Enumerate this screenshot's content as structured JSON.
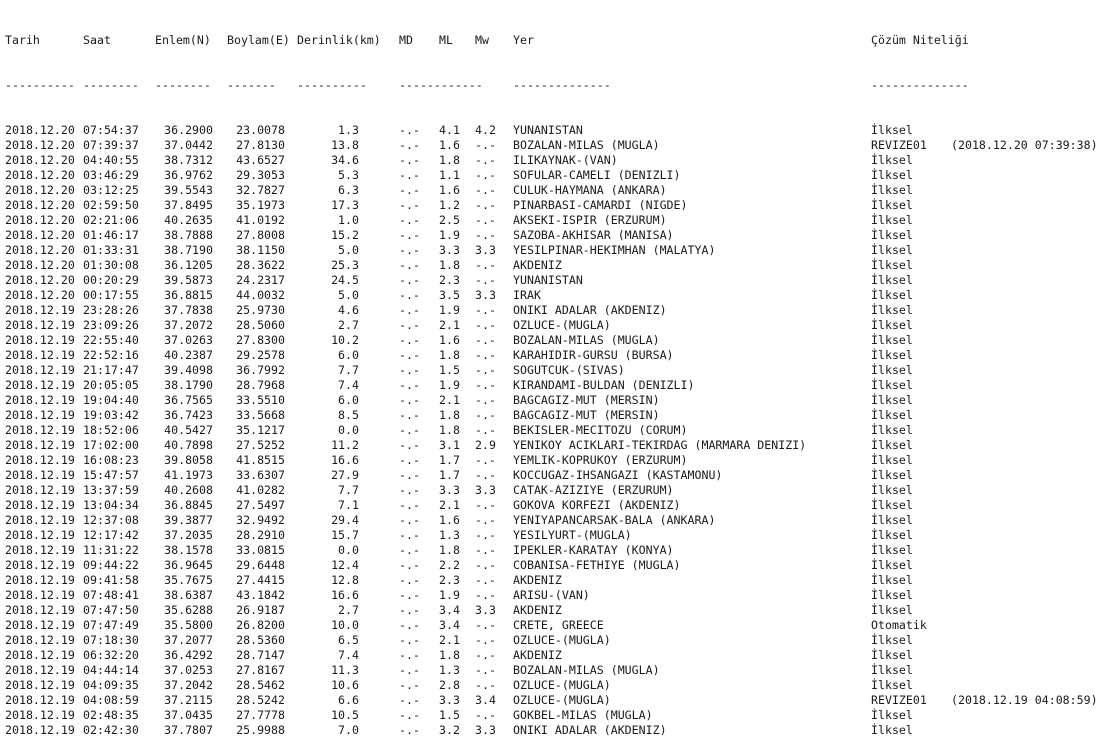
{
  "columns": {
    "date": "Tarih",
    "time": "Saat",
    "lat": "Enlem(N)",
    "lon": "Boylam(E)",
    "depth": "Derinlik(km)",
    "md": "MD",
    "ml": "ML",
    "mw": "Mw",
    "location": "Yer",
    "quality": "Çözüm Niteliği"
  },
  "separators": {
    "date": "----------",
    "time": "--------",
    "lat": "--------",
    "lon": "-------",
    "depth": "----------",
    "mags": "------------",
    "location": "--------------",
    "quality": "--------------"
  },
  "rows": [
    [
      "2018.12.20",
      "07:54:37",
      "36.2900",
      "23.0078",
      "1.3",
      "-.-",
      "4.1",
      "4.2",
      "YUNANISTAN",
      "İlksel",
      ""
    ],
    [
      "2018.12.20",
      "07:39:37",
      "37.0442",
      "27.8130",
      "13.8",
      "-.-",
      "1.6",
      "-.-",
      "BOZALAN-MILAS (MUGLA)",
      "REVIZE01",
      "(2018.12.20 07:39:38)"
    ],
    [
      "2018.12.20",
      "04:40:55",
      "38.7312",
      "43.6527",
      "34.6",
      "-.-",
      "1.8",
      "-.-",
      "ILIKAYNAK-(VAN)",
      "İlksel",
      ""
    ],
    [
      "2018.12.20",
      "03:46:29",
      "36.9762",
      "29.3053",
      "5.3",
      "-.-",
      "1.1",
      "-.-",
      "SOFULAR-CAMELI (DENIZLI)",
      "İlksel",
      ""
    ],
    [
      "2018.12.20",
      "03:12:25",
      "39.5543",
      "32.7827",
      "6.3",
      "-.-",
      "1.6",
      "-.-",
      "CULUK-HAYMANA (ANKARA)",
      "İlksel",
      ""
    ],
    [
      "2018.12.20",
      "02:59:50",
      "37.8495",
      "35.1973",
      "17.3",
      "-.-",
      "1.2",
      "-.-",
      "PINARBASI-CAMARDI (NIGDE)",
      "İlksel",
      ""
    ],
    [
      "2018.12.20",
      "02:21:06",
      "40.2635",
      "41.0192",
      "1.0",
      "-.-",
      "2.5",
      "-.-",
      "AKSEKI-ISPIR (ERZURUM)",
      "İlksel",
      ""
    ],
    [
      "2018.12.20",
      "01:46:17",
      "38.7888",
      "27.8008",
      "15.2",
      "-.-",
      "1.9",
      "-.-",
      "SAZOBA-AKHISAR (MANISA)",
      "İlksel",
      ""
    ],
    [
      "2018.12.20",
      "01:33:31",
      "38.7190",
      "38.1150",
      "5.0",
      "-.-",
      "3.3",
      "3.3",
      "YESILPINAR-HEKIMHAN (MALATYA)",
      "İlksel",
      ""
    ],
    [
      "2018.12.20",
      "01:30:08",
      "36.1205",
      "28.3622",
      "25.3",
      "-.-",
      "1.8",
      "-.-",
      "AKDENIZ",
      "İlksel",
      ""
    ],
    [
      "2018.12.20",
      "00:20:29",
      "39.5873",
      "24.2317",
      "24.5",
      "-.-",
      "2.3",
      "-.-",
      "YUNANISTAN",
      "İlksel",
      ""
    ],
    [
      "2018.12.20",
      "00:17:55",
      "36.8815",
      "44.0032",
      "5.0",
      "-.-",
      "3.5",
      "3.3",
      "IRAK",
      "İlksel",
      ""
    ],
    [
      "2018.12.19",
      "23:28:26",
      "37.7838",
      "25.9730",
      "4.6",
      "-.-",
      "1.9",
      "-.-",
      "ONIKI ADALAR (AKDENIZ)",
      "İlksel",
      ""
    ],
    [
      "2018.12.19",
      "23:09:26",
      "37.2072",
      "28.5060",
      "2.7",
      "-.-",
      "2.1",
      "-.-",
      "OZLUCE-(MUGLA)",
      "İlksel",
      ""
    ],
    [
      "2018.12.19",
      "22:55:40",
      "37.0263",
      "27.8300",
      "10.2",
      "-.-",
      "1.6",
      "-.-",
      "BOZALAN-MILAS (MUGLA)",
      "İlksel",
      ""
    ],
    [
      "2018.12.19",
      "22:52:16",
      "40.2387",
      "29.2578",
      "6.0",
      "-.-",
      "1.8",
      "-.-",
      "KARAHIDIR-GURSU (BURSA)",
      "İlksel",
      ""
    ],
    [
      "2018.12.19",
      "21:17:47",
      "39.4098",
      "36.7992",
      "7.7",
      "-.-",
      "1.5",
      "-.-",
      "SOGUTCUK-(SIVAS)",
      "İlksel",
      ""
    ],
    [
      "2018.12.19",
      "20:05:05",
      "38.1790",
      "28.7968",
      "7.4",
      "-.-",
      "1.9",
      "-.-",
      "KIRANDAMI-BULDAN (DENIZLI)",
      "İlksel",
      ""
    ],
    [
      "2018.12.19",
      "19:04:40",
      "36.7565",
      "33.5510",
      "6.0",
      "-.-",
      "2.1",
      "-.-",
      "BAGCAGIZ-MUT (MERSIN)",
      "İlksel",
      ""
    ],
    [
      "2018.12.19",
      "19:03:42",
      "36.7423",
      "33.5668",
      "8.5",
      "-.-",
      "1.8",
      "-.-",
      "BAGCAGIZ-MUT (MERSIN)",
      "İlksel",
      ""
    ],
    [
      "2018.12.19",
      "18:52:06",
      "40.5427",
      "35.1217",
      "0.0",
      "-.-",
      "1.8",
      "-.-",
      "BEKISLER-MECITOZU (CORUM)",
      "İlksel",
      ""
    ],
    [
      "2018.12.19",
      "17:02:00",
      "40.7898",
      "27.5252",
      "11.2",
      "-.-",
      "3.1",
      "2.9",
      "YENIKOY ACIKLARI-TEKIRDAG (MARMARA DENIZI)",
      "İlksel",
      ""
    ],
    [
      "2018.12.19",
      "16:08:23",
      "39.8058",
      "41.8515",
      "16.6",
      "-.-",
      "1.7",
      "-.-",
      "YEMLIK-KOPRUKOY (ERZURUM)",
      "İlksel",
      ""
    ],
    [
      "2018.12.19",
      "15:47:57",
      "41.1973",
      "33.6307",
      "27.9",
      "-.-",
      "1.7",
      "-.-",
      "KOCCUGAZ-IHSANGAZI (KASTAMONU)",
      "İlksel",
      ""
    ],
    [
      "2018.12.19",
      "13:37:59",
      "40.2608",
      "41.0282",
      "7.7",
      "-.-",
      "3.3",
      "3.3",
      "CATAK-AZIZIYE (ERZURUM)",
      "İlksel",
      ""
    ],
    [
      "2018.12.19",
      "13:04:34",
      "36.8845",
      "27.5497",
      "7.1",
      "-.-",
      "2.1",
      "-.-",
      "GOKOVA KORFEZI (AKDENIZ)",
      "İlksel",
      ""
    ],
    [
      "2018.12.19",
      "12:37:08",
      "39.3877",
      "32.9492",
      "29.4",
      "-.-",
      "1.6",
      "-.-",
      "YENIYAPANCARSAK-BALA (ANKARA)",
      "İlksel",
      ""
    ],
    [
      "2018.12.19",
      "12:17:42",
      "37.2035",
      "28.2910",
      "15.7",
      "-.-",
      "1.3",
      "-.-",
      "YESILYURT-(MUGLA)",
      "İlksel",
      ""
    ],
    [
      "2018.12.19",
      "11:31:22",
      "38.1578",
      "33.0815",
      "0.0",
      "-.-",
      "1.8",
      "-.-",
      "IPEKLER-KARATAY (KONYA)",
      "İlksel",
      ""
    ],
    [
      "2018.12.19",
      "09:44:22",
      "36.9645",
      "29.6448",
      "12.4",
      "-.-",
      "2.2",
      "-.-",
      "COBANISA-FETHIYE (MUGLA)",
      "İlksel",
      ""
    ],
    [
      "2018.12.19",
      "09:41:58",
      "35.7675",
      "27.4415",
      "12.8",
      "-.-",
      "2.3",
      "-.-",
      "AKDENIZ",
      "İlksel",
      ""
    ],
    [
      "2018.12.19",
      "07:48:41",
      "38.6387",
      "43.1842",
      "16.6",
      "-.-",
      "1.9",
      "-.-",
      "ARISU-(VAN)",
      "İlksel",
      ""
    ],
    [
      "2018.12.19",
      "07:47:50",
      "35.6288",
      "26.9187",
      "2.7",
      "-.-",
      "3.4",
      "3.3",
      "AKDENIZ",
      "İlksel",
      ""
    ],
    [
      "2018.12.19",
      "07:47:49",
      "35.5800",
      "26.8200",
      "10.0",
      "-.-",
      "3.4",
      "-.-",
      "CRETE, GREECE",
      "Otomatik",
      ""
    ],
    [
      "2018.12.19",
      "07:18:30",
      "37.2077",
      "28.5360",
      "6.5",
      "-.-",
      "2.1",
      "-.-",
      "OZLUCE-(MUGLA)",
      "İlksel",
      ""
    ],
    [
      "2018.12.19",
      "06:32:20",
      "36.4292",
      "28.7147",
      "7.4",
      "-.-",
      "1.8",
      "-.-",
      "AKDENIZ",
      "İlksel",
      ""
    ],
    [
      "2018.12.19",
      "04:44:14",
      "37.0253",
      "27.8167",
      "11.3",
      "-.-",
      "1.3",
      "-.-",
      "BOZALAN-MILAS (MUGLA)",
      "İlksel",
      ""
    ],
    [
      "2018.12.19",
      "04:09:35",
      "37.2042",
      "28.5462",
      "10.6",
      "-.-",
      "2.8",
      "-.-",
      "OZLUCE-(MUGLA)",
      "İlksel",
      ""
    ],
    [
      "2018.12.19",
      "04:08:59",
      "37.2115",
      "28.5242",
      "6.6",
      "-.-",
      "3.3",
      "3.4",
      "OZLUCE-(MUGLA)",
      "REVIZE01",
      "(2018.12.19 04:08:59)"
    ],
    [
      "2018.12.19",
      "02:48:35",
      "37.0435",
      "27.7778",
      "10.5",
      "-.-",
      "1.5",
      "-.-",
      "GOKBEL-MILAS (MUGLA)",
      "İlksel",
      ""
    ],
    [
      "2018.12.19",
      "02:42:30",
      "37.7807",
      "25.9988",
      "7.0",
      "-.-",
      "3.2",
      "3.3",
      "ONIKI ADALAR (AKDENIZ)",
      "İlksel",
      ""
    ]
  ]
}
